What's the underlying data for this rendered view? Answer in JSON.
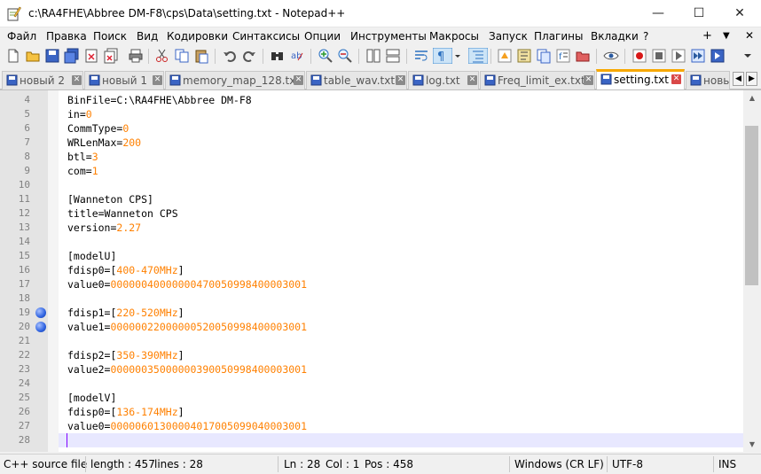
{
  "window": {
    "title": "c:\\RA4FHE\\Abbree DM-F8\\cps\\Data\\setting.txt - Notepad++",
    "minimize": "—",
    "maximize": "☐",
    "close": "✕"
  },
  "menu": {
    "items": [
      "Файл",
      "Правка",
      "Поиск",
      "Вид",
      "Кодировки",
      "Синтаксисы",
      "Опции",
      "Инструменты",
      "Макросы",
      "Запуск",
      "Плагины",
      "Вкладки",
      "?"
    ],
    "add": "+",
    "dropdown": "▼",
    "close": "✕"
  },
  "tabs": [
    {
      "label": "новый 2"
    },
    {
      "label": "новый 1"
    },
    {
      "label": "memory_map_128.txt"
    },
    {
      "label": "table_wav.txt"
    },
    {
      "label": "log.txt"
    },
    {
      "label": "Freq_limit_ex.txt"
    },
    {
      "label": "setting.txt",
      "active": true
    },
    {
      "label": "новы"
    }
  ],
  "tab_close_glyph": "✕",
  "tab_scroll": {
    "left": "◀",
    "right": "▶"
  },
  "editor": {
    "lines": [
      {
        "n": "4",
        "k": "BinFile=C:\\RA4FHE\\Abbree DM-F8",
        "v": ""
      },
      {
        "n": "5",
        "k": "in=",
        "v": "0"
      },
      {
        "n": "6",
        "k": "CommType=",
        "v": "0"
      },
      {
        "n": "7",
        "k": "WRLenMax=",
        "v": "200"
      },
      {
        "n": "8",
        "k": "btl=",
        "v": "3"
      },
      {
        "n": "9",
        "k": "com=",
        "v": "1"
      },
      {
        "n": "10",
        "k": "",
        "v": ""
      },
      {
        "n": "11",
        "k": "[Wanneton CPS]",
        "v": ""
      },
      {
        "n": "12",
        "k": "title=Wanneton CPS",
        "v": ""
      },
      {
        "n": "13",
        "k": "version=",
        "v": "2.27"
      },
      {
        "n": "14",
        "k": "",
        "v": ""
      },
      {
        "n": "15",
        "k": "[modelU]",
        "v": ""
      },
      {
        "n": "16",
        "k": "fdisp0=[",
        "v": "400-470MHz",
        "k2": "]"
      },
      {
        "n": "17",
        "k": "value0=",
        "v": "00000040000000470050998400003001"
      },
      {
        "n": "18",
        "k": "",
        "v": ""
      },
      {
        "n": "19",
        "k": "fdisp1=[",
        "v": "220-520MHz",
        "k2": "]",
        "bookmark": true
      },
      {
        "n": "20",
        "k": "value1=",
        "v": "00000022000000520050998400003001",
        "bookmark": true
      },
      {
        "n": "21",
        "k": "",
        "v": ""
      },
      {
        "n": "22",
        "k": "fdisp2=[",
        "v": "350-390MHz",
        "k2": "]"
      },
      {
        "n": "23",
        "k": "value2=",
        "v": "00000035000000390050998400003001"
      },
      {
        "n": "24",
        "k": "",
        "v": ""
      },
      {
        "n": "25",
        "k": "[modelV]",
        "v": ""
      },
      {
        "n": "26",
        "k": "fdisp0=[",
        "v": "136-174MHz",
        "k2": "]"
      },
      {
        "n": "27",
        "k": "value0=",
        "v": "00000601300004017005099040003001"
      },
      {
        "n": "28",
        "k": "",
        "v": "",
        "current": true
      }
    ]
  },
  "scrollbar": {
    "up": "▲",
    "down": "▼"
  },
  "status": {
    "language": "C++ source file",
    "length": "length : 457",
    "lines": "lines : 28",
    "ln": "Ln : 28",
    "col": "Col : 1",
    "pos": "Pos : 458",
    "eol": "Windows (CR LF)",
    "encoding": "UTF-8",
    "mode": "INS"
  }
}
